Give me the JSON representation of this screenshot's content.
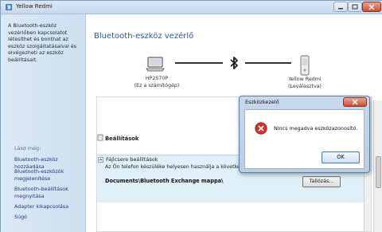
{
  "window": {
    "title": "Yellow Redmi"
  },
  "sidebar": {
    "intro": "A Bluetooth-eszköz vezérlőben kapcsolatot létesíthet és bonthat az eszköz szolgáltatásaival és elvégezheti az eszköz beállításait.",
    "see_also_label": "Lásd még:",
    "links": [
      "Bluetooth-eszköz hozzáadása",
      "Bluetooth-eszközök megjelenítése",
      "Bluetooth-beállítások megnyitása",
      "Adapter kikapcsolása",
      "Súgó"
    ]
  },
  "main": {
    "title": "Bluetooth-eszköz vezérlő",
    "computer": {
      "name": "HP2570P",
      "subtitle": "(Ez a számítógép)"
    },
    "phone": {
      "name": "Yellow Redmi",
      "subtitle": "(Leválasztva)"
    },
    "settings_header": "Beállítások",
    "file_transfer": {
      "title": "Fájlcsere beállítások",
      "description": "Az Ön telefon készüléke helyesen használja a következő",
      "path": "Documents\\Bluetooth Exchange mappa\\",
      "browse_label": "Tallózás..."
    }
  },
  "dialog": {
    "title": "Eszközkezelő",
    "message": "Nincs megadva eszközazonosító.",
    "ok_label": "OK"
  },
  "colors": {
    "accent": "#1e5aa8",
    "error": "#d32f2f",
    "bluetooth": "#1a1a1a"
  }
}
